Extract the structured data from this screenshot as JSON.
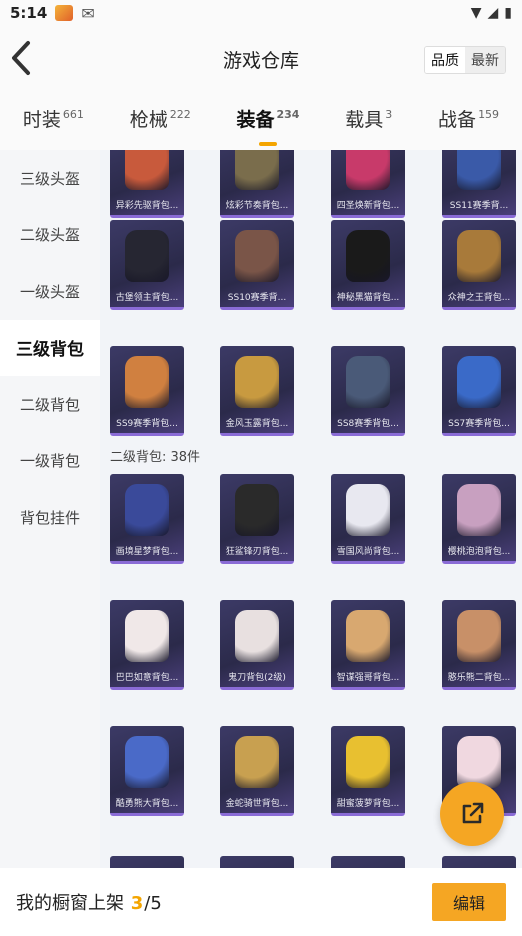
{
  "status_bar": {
    "time": "5:14"
  },
  "header": {
    "title": "游戏仓库",
    "sort_quality": "品质",
    "sort_newest": "最新"
  },
  "tabs": [
    {
      "label": "时装",
      "count": "661"
    },
    {
      "label": "枪械",
      "count": "222"
    },
    {
      "label": "装备",
      "count": "234"
    },
    {
      "label": "载具",
      "count": "3"
    },
    {
      "label": "战备",
      "count": "159"
    }
  ],
  "sidebar": [
    {
      "label": "三级头盔"
    },
    {
      "label": "二级头盔"
    },
    {
      "label": "一级头盔"
    },
    {
      "label": "三级背包"
    },
    {
      "label": "二级背包"
    },
    {
      "label": "一级背包"
    },
    {
      "label": "背包挂件"
    }
  ],
  "rows": [
    {
      "items": [
        "异彩先驱背包...",
        "炫彩节奏背包...",
        "四圣焕新背包...",
        "SS11赛季背..."
      ]
    },
    {
      "items": [
        "古堡领主背包...",
        "SS10赛季背...",
        "神秘黑猫背包...",
        "众神之王背包..."
      ]
    },
    {
      "items": [
        "SS9赛季背包...",
        "金风玉露背包...",
        "SS8赛季背包...",
        "SS7赛季背包..."
      ]
    },
    {
      "items": [
        "画境星梦背包...",
        "狂鲨锋刃背包...",
        "雪国风尚背包...",
        "樱桃泡泡背包..."
      ]
    },
    {
      "items": [
        "巴巴如意背包...",
        "鬼刀背包(2级)",
        "智谋强哥背包...",
        "憨乐熊二背包..."
      ]
    },
    {
      "items": [
        "酷勇熊大背包...",
        "金蛇骑世背包...",
        "甜蜜菠萝背包...",
        ""
      ]
    }
  ],
  "section_label": "二级背包: 38件",
  "bottom": {
    "label_prefix": "我的橱窗上架 ",
    "count": "3",
    "suffix": "/5",
    "edit": "编辑"
  },
  "colors": {
    "accent": "#f5a623"
  }
}
